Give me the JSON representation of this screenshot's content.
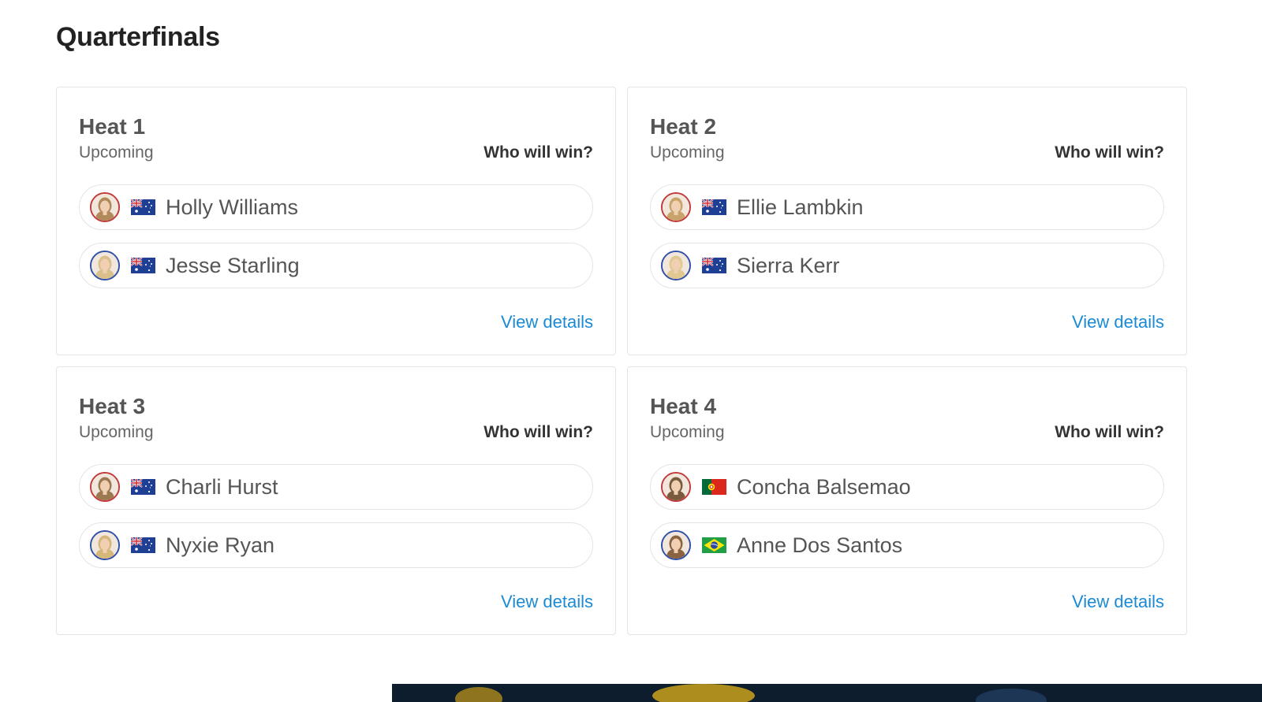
{
  "section": {
    "title": "Quarterfinals"
  },
  "heats": [
    {
      "name": "Heat 1",
      "status": "Upcoming",
      "prompt": "Who will win?",
      "link": "View details",
      "surfers": [
        {
          "name": "Holly Williams",
          "flag": "australia-flag-icon",
          "jersey": "red"
        },
        {
          "name": "Jesse Starling",
          "flag": "australia-flag-icon",
          "jersey": "blue"
        }
      ]
    },
    {
      "name": "Heat 2",
      "status": "Upcoming",
      "prompt": "Who will win?",
      "link": "View details",
      "surfers": [
        {
          "name": "Ellie Lambkin",
          "flag": "australia-flag-icon",
          "jersey": "red"
        },
        {
          "name": "Sierra Kerr",
          "flag": "australia-flag-icon",
          "jersey": "blue"
        }
      ]
    },
    {
      "name": "Heat 3",
      "status": "Upcoming",
      "prompt": "Who will win?",
      "link": "View details",
      "surfers": [
        {
          "name": "Charli Hurst",
          "flag": "australia-flag-icon",
          "jersey": "red"
        },
        {
          "name": "Nyxie Ryan",
          "flag": "australia-flag-icon",
          "jersey": "blue"
        }
      ]
    },
    {
      "name": "Heat 4",
      "status": "Upcoming",
      "prompt": "Who will win?",
      "link": "View details",
      "surfers": [
        {
          "name": "Concha Balsemao",
          "flag": "portugal-flag-icon",
          "jersey": "red"
        },
        {
          "name": "Anne Dos Santos",
          "flag": "brazil-flag-icon",
          "jersey": "blue"
        }
      ]
    }
  ],
  "colors": {
    "link": "#1a8ad6",
    "jersey_red": "#c23a3a",
    "jersey_blue": "#2f4fa8",
    "card_border": "#e4e4e4"
  }
}
